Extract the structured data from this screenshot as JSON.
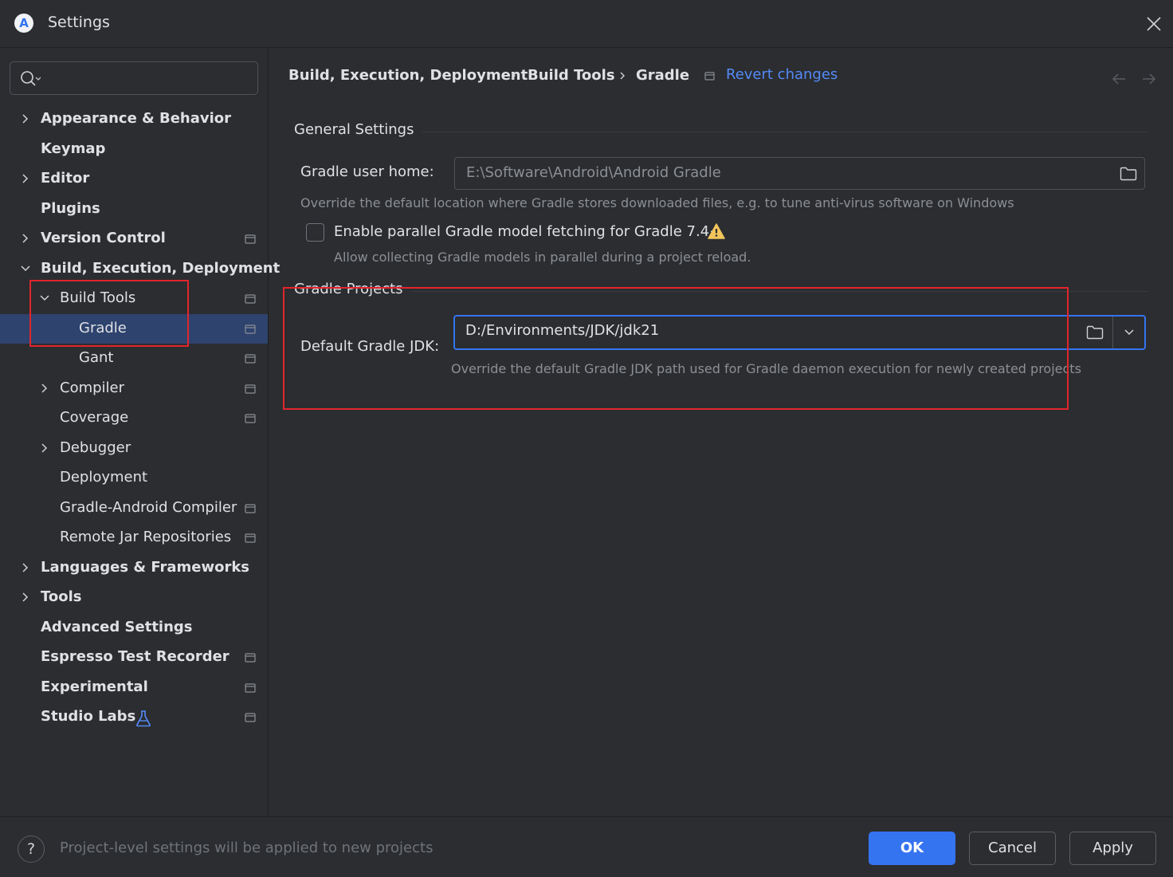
{
  "window": {
    "title": "Settings"
  },
  "sidebar": {
    "search_placeholder": "",
    "items": [
      {
        "label": "Appearance & Behavior"
      },
      {
        "label": "Keymap"
      },
      {
        "label": "Editor"
      },
      {
        "label": "Plugins"
      },
      {
        "label": "Version Control"
      },
      {
        "label": "Build, Execution, Deployment"
      },
      {
        "label": "Build Tools"
      },
      {
        "label": "Gradle"
      },
      {
        "label": "Gant"
      },
      {
        "label": "Compiler"
      },
      {
        "label": "Coverage"
      },
      {
        "label": "Debugger"
      },
      {
        "label": "Deployment"
      },
      {
        "label": "Gradle-Android Compiler"
      },
      {
        "label": "Remote Jar Repositories"
      },
      {
        "label": "Languages & Frameworks"
      },
      {
        "label": "Tools"
      },
      {
        "label": "Advanced Settings"
      },
      {
        "label": "Espresso Test Recorder"
      },
      {
        "label": "Experimental"
      },
      {
        "label": "Studio Labs"
      }
    ]
  },
  "breadcrumb": {
    "items": [
      "Build, Execution, Deployment",
      "Build Tools",
      "Gradle"
    ],
    "revert_label": "Revert changes"
  },
  "general": {
    "section_title": "General Settings",
    "user_home_label": "Gradle user home:",
    "user_home_value": "E:\\Software\\Android\\Android Gradle",
    "user_home_hint": "Override the default location where Gradle stores downloaded files, e.g. to tune anti-virus software on Windows",
    "parallel_label": "Enable parallel Gradle model fetching for Gradle 7.4+",
    "parallel_checked": false,
    "parallel_hint": "Allow collecting Gradle models in parallel during a project reload."
  },
  "projects": {
    "section_title": "Gradle Projects",
    "jdk_label": "Default Gradle JDK:",
    "jdk_value": "D:/Environments/JDK/jdk21",
    "jdk_hint": "Override the default Gradle JDK path used for Gradle daemon execution for newly created projects"
  },
  "footer": {
    "help_label": "?",
    "note": "Project-level settings will be applied to new projects",
    "ok_label": "OK",
    "cancel_label": "Cancel",
    "apply_label": "Apply"
  },
  "colors": {
    "background": "#2b2d30",
    "accent": "#3574f0",
    "selection": "#2e436e",
    "link": "#548af7",
    "annotation": "#e0262c",
    "warning": "#f2c55c"
  }
}
